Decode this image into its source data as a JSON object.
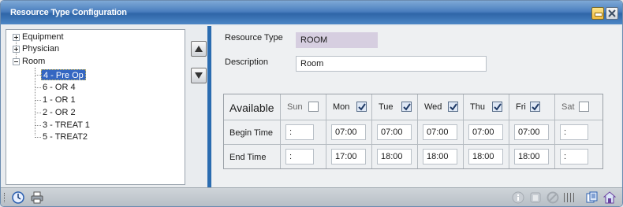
{
  "window": {
    "title": "Resource Type Configuration",
    "accent": "#2b6cb0",
    "selection_color": "#3466c2"
  },
  "tree": {
    "items": [
      {
        "label": "Equipment",
        "expanded": false
      },
      {
        "label": "Physician",
        "expanded": false
      },
      {
        "label": "Room",
        "expanded": true,
        "children": [
          "4 - Pre Op",
          "6 - OR 4",
          "1 - OR 1",
          "2 - OR 2",
          "3 - TREAT 1",
          "5 - TREAT2"
        ],
        "selected": "4 - Pre Op"
      }
    ]
  },
  "side_buttons": {
    "up_icon": "move-up-icon",
    "down_icon": "move-down-icon"
  },
  "form": {
    "resource_type_label": "Resource Type",
    "resource_type_value": "ROOM",
    "description_label": "Description",
    "description_value": "Room"
  },
  "schedule": {
    "available_label": "Available",
    "begin_label": "Begin Time",
    "end_label": "End Time",
    "days": [
      {
        "name": "Sun",
        "checked": false,
        "begin": ":",
        "end": ":"
      },
      {
        "name": "Mon",
        "checked": true,
        "begin": "07:00",
        "end": "17:00"
      },
      {
        "name": "Tue",
        "checked": true,
        "begin": "07:00",
        "end": "18:00"
      },
      {
        "name": "Wed",
        "checked": true,
        "begin": "07:00",
        "end": "18:00"
      },
      {
        "name": "Thu",
        "checked": true,
        "begin": "07:00",
        "end": "18:00"
      },
      {
        "name": "Fri",
        "checked": true,
        "begin": "07:00",
        "end": "18:00"
      },
      {
        "name": "Sat",
        "checked": false,
        "begin": ":",
        "end": ":"
      }
    ]
  },
  "statusbar": {
    "left_icons": [
      "clock-icon",
      "printer-icon"
    ],
    "right_icons": [
      "info-icon",
      "delete-icon",
      "cancel-icon",
      "copy-icon",
      "save-icon"
    ]
  }
}
